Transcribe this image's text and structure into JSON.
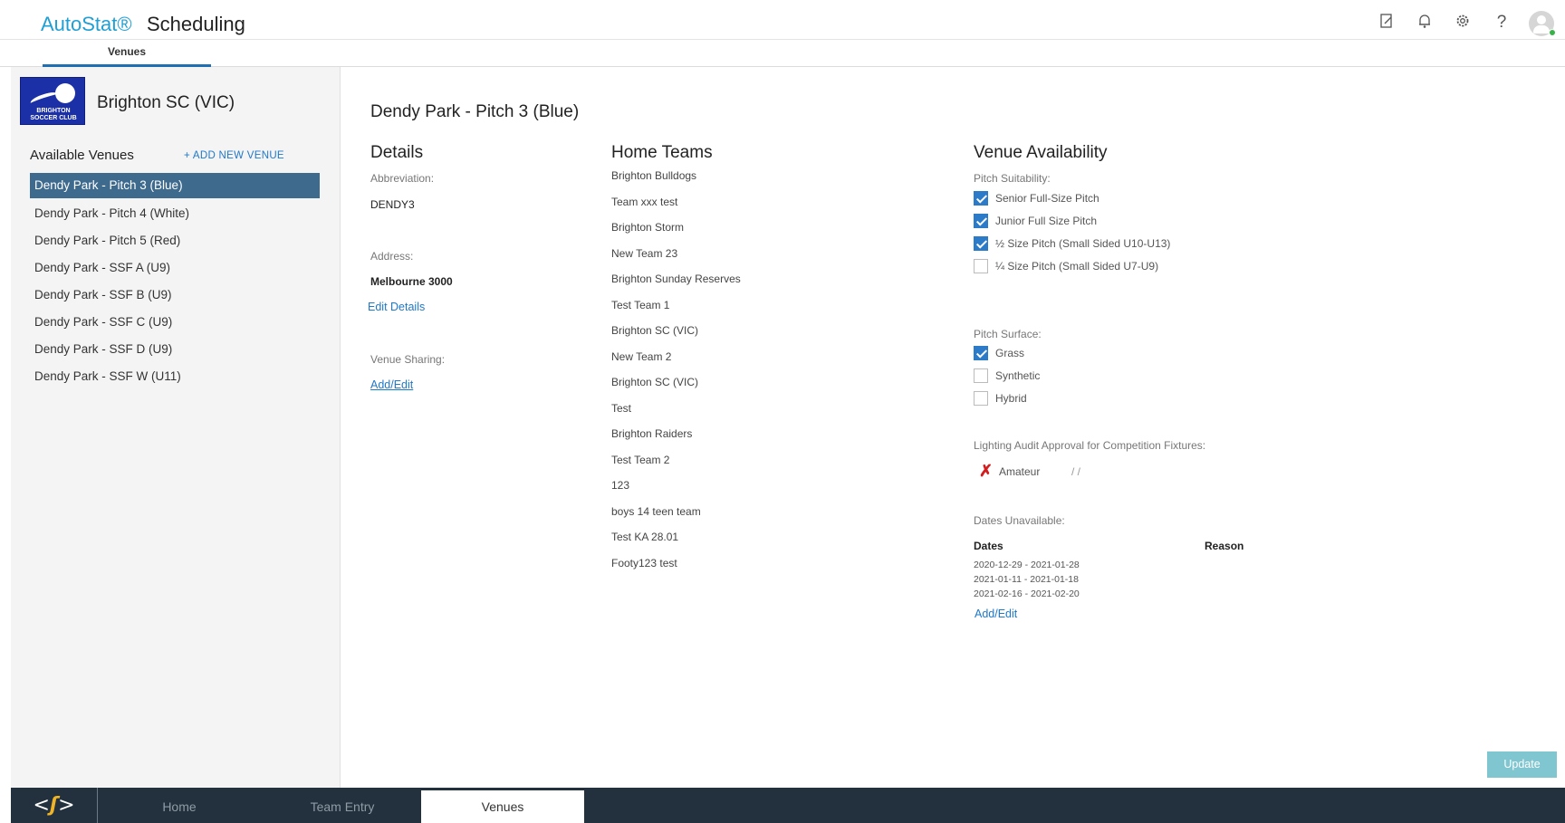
{
  "app": {
    "brand": "AutoStat®",
    "title": "Scheduling"
  },
  "header_icons": [
    "notes-icon",
    "bell-icon",
    "gear-icon",
    "help-icon",
    "user-avatar-icon"
  ],
  "help_glyph": "?",
  "subtabs": {
    "active": "Venues"
  },
  "sidebar": {
    "club_name": "Brighton SC (VIC)",
    "logo_text": "BRIGHTON SOCCER CLUB",
    "available_label": "Available Venues",
    "add_venue": "+ ADD NEW VENUE",
    "venues": [
      "Dendy Park - Pitch 3 (Blue)",
      "Dendy Park - Pitch 4 (White)",
      "Dendy Park - Pitch 5 (Red)",
      "Dendy Park - SSF A (U9)",
      "Dendy Park - SSF B (U9)",
      "Dendy Park - SSF C (U9)",
      "Dendy Park - SSF D (U9)",
      "Dendy Park - SSF W (U11)"
    ],
    "selected_index": 0
  },
  "main": {
    "title": "Dendy Park - Pitch 3 (Blue)",
    "details": {
      "heading": "Details",
      "abbr_label": "Abbreviation:",
      "abbr_value": "DENDY3",
      "address_label": "Address:",
      "address_value": "Melbourne 3000",
      "edit_link": "Edit Details",
      "sharing_label": "Venue Sharing:",
      "sharing_link": "Add/Edit"
    },
    "home_teams": {
      "heading": "Home Teams",
      "teams": [
        "Brighton Bulldogs",
        "Team xxx test",
        "Brighton Storm",
        "New Team 23",
        "Brighton Sunday Reserves",
        "Test Team 1",
        "Brighton SC (VIC)",
        "New Team 2",
        "Brighton SC (VIC)",
        "Test",
        "Brighton Raiders",
        "Test Team 2",
        "123",
        "boys 14 teen team",
        "Test KA 28.01",
        "Footy123 test"
      ]
    },
    "availability": {
      "heading": "Venue Availability",
      "pitch_suitability_label": "Pitch Suitability:",
      "pitch_suitability": [
        {
          "label": "Senior Full-Size Pitch",
          "checked": true
        },
        {
          "label": "Junior Full Size Pitch",
          "checked": true
        },
        {
          "label": "½ Size Pitch (Small Sided U10-U13)",
          "checked": true
        },
        {
          "label": "¼ Size Pitch (Small Sided U7-U9)",
          "checked": false
        }
      ],
      "pitch_surface_label": "Pitch Surface:",
      "pitch_surface": [
        {
          "label": "Grass",
          "checked": true
        },
        {
          "label": "Synthetic",
          "checked": false
        },
        {
          "label": "Hybrid",
          "checked": false
        }
      ],
      "lighting_label": "Lighting Audit Approval for Competition Fixtures:",
      "lighting": {
        "mark": "✗",
        "level": "Amateur",
        "date": "/ /"
      },
      "dates_unavailable_label": "Dates Unavailable:",
      "dates_header": "Dates",
      "reason_header": "Reason",
      "dates": [
        "2020-12-29 - 2021-01-28",
        "2021-01-11 - 2021-01-18",
        "2021-02-16 - 2021-02-20"
      ],
      "add_edit_link": "Add/Edit"
    },
    "update_button": "Update"
  },
  "bottom_nav": {
    "tabs": [
      "Home",
      "Team Entry",
      "Venues"
    ],
    "active": "Venues"
  },
  "colors": {
    "brand_blue": "#1f9fd4",
    "selected_row": "#3e6a8e",
    "checkbox": "#2b7bc9",
    "bottom_bar": "#22313d",
    "update_button": "#7fc6d0"
  }
}
